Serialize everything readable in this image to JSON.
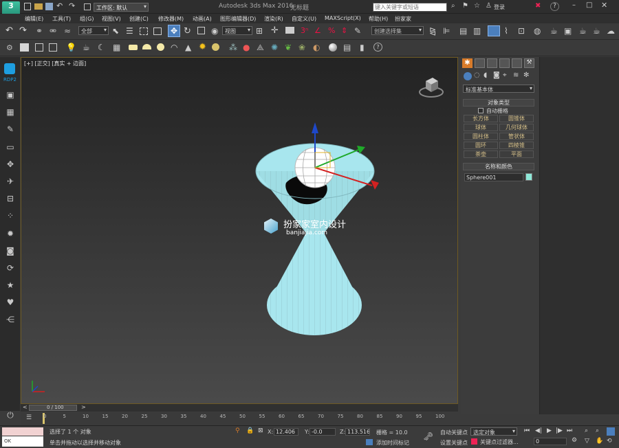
{
  "titlebar": {
    "workspace_label": "工作区: 默认",
    "app_title": "Autodesk 3ds Max 2016",
    "file_name": "无标题",
    "search_placeholder": "键入关键字或短语",
    "login_label": "登录",
    "help_label": "?"
  },
  "menu": [
    "编辑(E)",
    "工具(T)",
    "组(G)",
    "视图(V)",
    "创建(C)",
    "修改器(M)",
    "动画(A)",
    "图形编辑器(D)",
    "渲染(R)",
    "自定义(U)",
    "MAXScript(X)",
    "帮助(H)",
    "扮家家"
  ],
  "toolbar": {
    "filter_value": "全部",
    "refcoord_value": "视图",
    "selset_placeholder": "创建选择集",
    "percent_label": "%"
  },
  "leftbar": {
    "rdp_label": "RDP2"
  },
  "viewport": {
    "label": "[+] [正交] [真实 + 边面]",
    "watermark_title": "扮家家室内设计",
    "watermark_url": "banjiajia.com"
  },
  "panel": {
    "category_value": "标准基本体",
    "object_type_header": "对象类型",
    "autogrid_label": "自动栅格",
    "object_buttons": [
      "长方体",
      "圆锥体",
      "球体",
      "几何球体",
      "圆柱体",
      "管状体",
      "圆环",
      "四棱锥",
      "茶壶",
      "平面"
    ],
    "name_color_header": "名称和颜色",
    "object_name": "Sphere001",
    "object_color": "#8ee8d8"
  },
  "timeline": {
    "frame_display": "0 / 100",
    "ticks": [
      "0",
      "5",
      "10",
      "15",
      "20",
      "25",
      "30",
      "35",
      "40",
      "45",
      "50",
      "55",
      "60",
      "65",
      "70",
      "75",
      "80",
      "85",
      "90",
      "95",
      "100"
    ]
  },
  "status": {
    "ok_label": "OK",
    "selection_info": "选择了 1 个 对象",
    "prompt": "单击并拖动以选择并移动对象",
    "x_value": "12.406",
    "y_value": "-0.0",
    "z_value": "113.516",
    "grid_value": "栅格 = 10.0",
    "add_time_tag": "添加时间标记",
    "auto_key": "自动关键点",
    "set_key": "设置关键点",
    "sel_object": "选定对象",
    "key_filters": "关键点过滤器...",
    "frame_value": "0"
  },
  "colors": {
    "accent": "#1e9ee0",
    "viewport_border": "#6e5a22",
    "object_fill": "#a8e6ee"
  }
}
